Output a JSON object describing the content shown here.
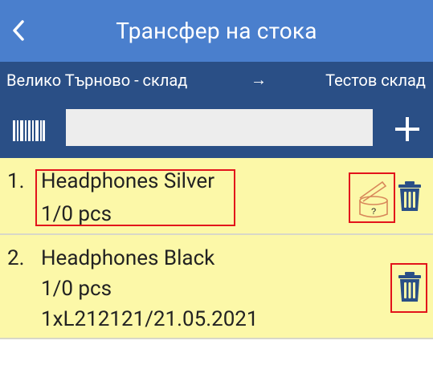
{
  "header": {
    "title": "Трансфер на стока"
  },
  "route": {
    "from": "Велико Търново - склад",
    "arrow": "→",
    "to": "Тестов склад"
  },
  "search": {
    "value": "",
    "placeholder": ""
  },
  "items": [
    {
      "index": "1.",
      "name": "Headphones Silver",
      "qty": "1/0 pcs",
      "lot_icon_text": "?"
    },
    {
      "index": "2.",
      "name": "Headphones Black",
      "qty": "1/0 pcs",
      "lot": "1xL212121/21.05.2021"
    }
  ],
  "colors": {
    "header": "#4a7fcd",
    "bar": "#2a4f86",
    "item_bg": "#fcf8a8",
    "highlight": "#e2131b",
    "trash": "#2a4f86",
    "lot_icon": "#d8875a"
  }
}
